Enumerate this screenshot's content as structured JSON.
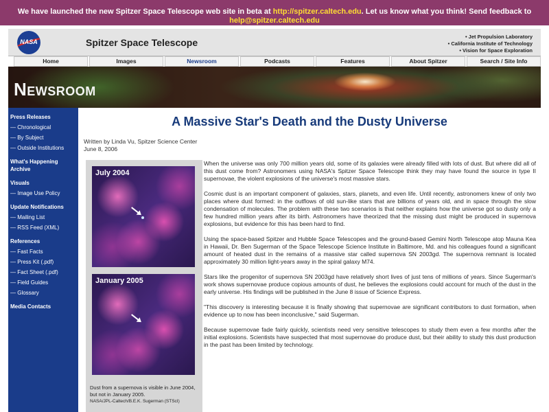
{
  "banner": {
    "text_before": "We have launched the new Spitzer Space Telescope web site in beta at ",
    "link_url_text": "http://spitzer.caltech.edu",
    "text_middle": ". Let us know what you think! Send feedback to ",
    "link_email_text": "help@spitzer.caltech.edu"
  },
  "header": {
    "logo_text": "NASA",
    "site_title": "Spitzer Space Telescope",
    "institutions": [
      "• Jet Propulsion Laboratory",
      "• California Institute of Technology",
      "• Vision for Space Exploration"
    ]
  },
  "nav": {
    "tabs": [
      {
        "label": "Home"
      },
      {
        "label": "Images"
      },
      {
        "label": "Newsroom"
      },
      {
        "label": "Podcasts"
      },
      {
        "label": "Features"
      },
      {
        "label": "About Spitzer"
      },
      {
        "label": "Search / Site Info"
      }
    ]
  },
  "hero": {
    "title": "Newsroom"
  },
  "sidebar": {
    "press_releases": "Press Releases",
    "chronological": "— Chronological",
    "by_subject": "— By Subject",
    "outside_institutions": "— Outside Institutions",
    "whats_happening": "What's Happening Archive",
    "visuals": "Visuals",
    "image_use_policy": "— Image Use Policy",
    "update_notifications": "Update Notifications",
    "mailing_list": "— Mailing List",
    "rss_feed": "— RSS Feed (XML)",
    "references": "References",
    "fast_facts": "— Fast Facts",
    "press_kit": "— Press Kit (.pdf)",
    "fact_sheet": "— Fact Sheet (.pdf)",
    "field_guides": "— Field Guides",
    "glossary": "— Glossary",
    "media_contacts": "Media Contacts"
  },
  "article": {
    "title": "A Massive Star's Death and the Dusty Universe",
    "byline": "Written by Linda Vu, Spitzer Science Center",
    "date": "June 8, 2006",
    "figure": {
      "label_top": "July 2004",
      "label_bottom": "January 2005",
      "caption": "Dust from a supernova is visible in June 2004, but not in January 2005.",
      "credit": "NASA/JPL-Caltech/B.E.K. Sugerman (STScI)"
    },
    "paragraphs": [
      "When the universe was only 700 million years old, some of its galaxies were already filled with lots of dust. But where did all of this dust come from? Astronomers using NASA's Spitzer Space Telescope think they may have found the source in type II supernovae, the violent explosions of the universe's most massive stars.",
      "Cosmic dust is an important component of galaxies, stars, planets, and even life. Until recently, astronomers knew of only two places where dust formed: in the outflows of old sun-like stars that are billions of years old, and in space through the slow condensation of molecules. The problem with these two scenarios is that neither explains how the universe got so dusty only a few hundred million years after its birth. Astronomers have theorized that the missing dust might be produced in supernova explosions, but evidence for this has been hard to find.",
      "Using the space-based Spitzer and Hubble Space Telescopes and the ground-based Gemini North Telescope atop Mauna Kea in Hawaii, Dr. Ben Sugerman of the Space Telescope Science Institute in Baltimore, Md. and his colleagues found a significant amount of heated dust in the remains of a massive star called supernova SN 2003gd. The supernova remnant is located approximately 30 million light-years away in the spiral galaxy M74.",
      "Stars like the progenitor of supernova SN 2003gd have relatively short lives of just tens of millions of years. Since Sugerman's work shows supernovae produce copious amounts of dust, he believes the explosions could account for much of the dust in the early universe. His findings will be published in the June 8 issue of Science Express.",
      "\"This discovery is interesting because it is finally showing that supernovae are significant contributors to dust formation, when evidence up to now has been inconclusive,\" said Sugerman.",
      "Because supernovae fade fairly quickly, scientists need very sensitive telescopes to study them even a few months after the initial explosions. Scientists have suspected that most supernovae do produce dust, but their ability to study this dust production in the past has been limited by technology."
    ]
  },
  "colors": {
    "banner_bg": "#8c3a6b",
    "banner_link": "#ffdd33",
    "sidebar_bg": "#1a3c8a",
    "title_color": "#173a7a"
  }
}
